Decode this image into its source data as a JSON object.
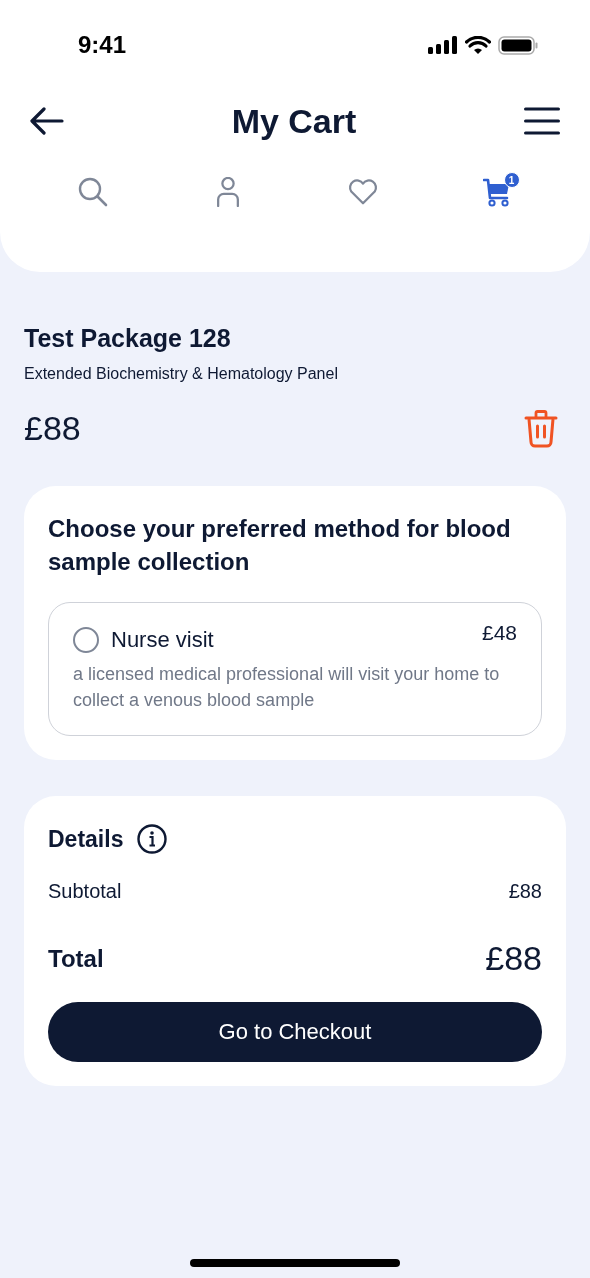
{
  "status_bar": {
    "time": "9:41"
  },
  "header": {
    "title": "My Cart"
  },
  "nav": [
    {
      "kind": "search",
      "selected": false
    },
    {
      "kind": "profile",
      "selected": false
    },
    {
      "kind": "favorites",
      "selected": false
    },
    {
      "kind": "cart",
      "selected": true,
      "badge": "1"
    }
  ],
  "product": {
    "name": "Test Package 128",
    "description": "Extended Biochemistry & Hematology Panel",
    "price": "£88"
  },
  "collection": {
    "heading": "Choose your preferred method for blood sample collection",
    "options": [
      {
        "label": "Nurse visit",
        "price": "£48",
        "description": "a licensed medical professional will visit your home to collect a venous blood sample",
        "selected": false
      }
    ]
  },
  "details": {
    "heading": "Details",
    "subtotal_label": "Subtotal",
    "subtotal": "£88",
    "total_label": "Total",
    "total": "£88",
    "checkout_button": "Go to Checkout"
  }
}
